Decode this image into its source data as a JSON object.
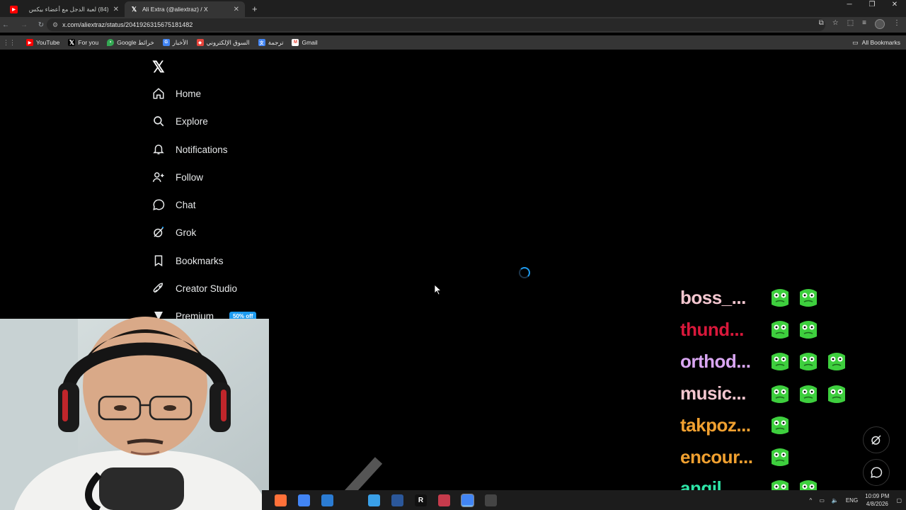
{
  "browser": {
    "tabs": [
      {
        "title": "(84) لعبة الدجل مع أعضاء بيكس",
        "favicon": "youtube-icon",
        "active": false
      },
      {
        "title": "Ali Extra (@aliextraz) / X",
        "favicon": "x-icon",
        "active": true
      }
    ],
    "url": "x.com/aliextraz/status/2041926315675181482",
    "bookmarks": [
      {
        "label": "YouTube",
        "icon": "youtube-icon",
        "color": "#ff0000"
      },
      {
        "label": "For you",
        "icon": "x-icon",
        "color": "#000000"
      },
      {
        "label": "Google خرائط",
        "icon": "maps-pin-icon",
        "color": "#34a853"
      },
      {
        "label": "الأخبار",
        "icon": "news-icon",
        "color": "#4285f4"
      },
      {
        "label": "السوق الإلكتروني",
        "icon": "store-icon",
        "color": "#e8453c"
      },
      {
        "label": "ترجمة",
        "icon": "translate-icon",
        "color": "#4285f4"
      },
      {
        "label": "Gmail",
        "icon": "gmail-icon",
        "color": "#ea4335"
      }
    ],
    "all_bookmarks": "All Bookmarks"
  },
  "nav": {
    "home": "Home",
    "explore": "Explore",
    "notifications": "Notifications",
    "follow": "Follow",
    "chat": "Chat",
    "grok": "Grok",
    "bookmarks": "Bookmarks",
    "creator_studio": "Creator Studio",
    "premium": "Premium",
    "premium_badge": "50% off"
  },
  "chat_overlay": [
    {
      "user": "boss_...",
      "color": "#f3c6cf",
      "emotes": 2
    },
    {
      "user": "thund...",
      "color": "#d9183b",
      "emotes": 2
    },
    {
      "user": "orthod...",
      "color": "#d9a6f2",
      "emotes": 3
    },
    {
      "user": "music...",
      "color": "#f3c6cf",
      "emotes": 3
    },
    {
      "user": "takpoz...",
      "color": "#f0a030",
      "emotes": 1
    },
    {
      "user": "encour...",
      "color": "#f0a030",
      "emotes": 1
    },
    {
      "user": "angil_...",
      "color": "#2ee6a8",
      "emotes": 2
    }
  ],
  "taskbar": {
    "language": "ENG",
    "time": "10:09 PM",
    "date": "4/8/2026",
    "apps": [
      "firefox-icon",
      "chrome-icon",
      "mail-icon",
      "explorer-icon",
      "word-icon",
      "r-app-icon",
      "game-icon",
      "chrome-active-icon",
      "obs-icon"
    ]
  },
  "colors": {
    "accent": "#1d9bf0",
    "emote_green": "#3ecf3e"
  }
}
